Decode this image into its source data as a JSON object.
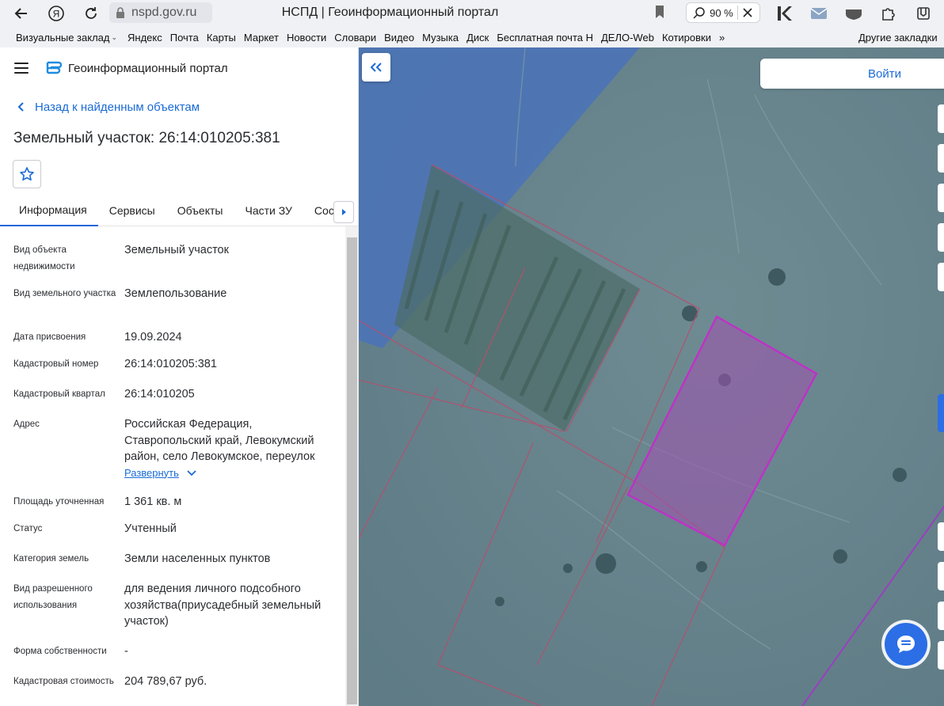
{
  "browser": {
    "url": "nspd.gov.ru",
    "title": "НСПД | Геоинформационный портал",
    "zoom": "90 %",
    "bookmarks": [
      "Визуальные заклад",
      "Яндекс",
      "Почта",
      "Карты",
      "Маркет",
      "Новости",
      "Словари",
      "Видео",
      "Музыка",
      "Диск",
      "Бесплатная почта Н",
      "ДЕЛО-Web",
      "Котировки"
    ],
    "bookmarks_more": "»",
    "other_bookmarks": "Другие закладки"
  },
  "panel": {
    "portal_title": "Геоинформационный портал",
    "back_link": "Назад к найденным объектам",
    "object_title": "Земельный участок: 26:14:010205:381",
    "tabs": [
      "Информация",
      "Сервисы",
      "Объекты",
      "Части ЗУ",
      "Состав"
    ],
    "info": [
      {
        "label": "Вид объекта недвижимости",
        "value": "Земельный участок"
      },
      {
        "label": "Вид земельного участка",
        "value": "Землепользование"
      },
      {
        "label": "Дата присвоения",
        "value": "19.09.2024"
      },
      {
        "label": "Кадастровый номер",
        "value": "26:14:010205:381"
      },
      {
        "label": "Кадастровый квартал",
        "value": "26:14:010205"
      },
      {
        "label": "Адрес",
        "value": "Российская Федерация, Ставропольский край, Левокумский район, село Левокумское, переулок"
      },
      {
        "label": "Площадь уточненная",
        "value": "1 361 кв. м"
      },
      {
        "label": "Статус",
        "value": "Учтенный"
      },
      {
        "label": "Категория земель",
        "value": "Земли населенных пунктов"
      },
      {
        "label": "Вид разрешенного использования",
        "value": "для ведения личного подсобного хозяйства(приусадебный земельный участок)"
      },
      {
        "label": "Форма собственности",
        "value": "-"
      },
      {
        "label": "Кадастровая стоимость",
        "value": "204 789,67 руб."
      }
    ],
    "expand_label": "Развернуть"
  },
  "map": {
    "login_label": "Войти"
  },
  "colors": {
    "accent": "#1a6bd6",
    "selected_parcel": "#c030c8",
    "parcel_border": "#b4506e"
  }
}
